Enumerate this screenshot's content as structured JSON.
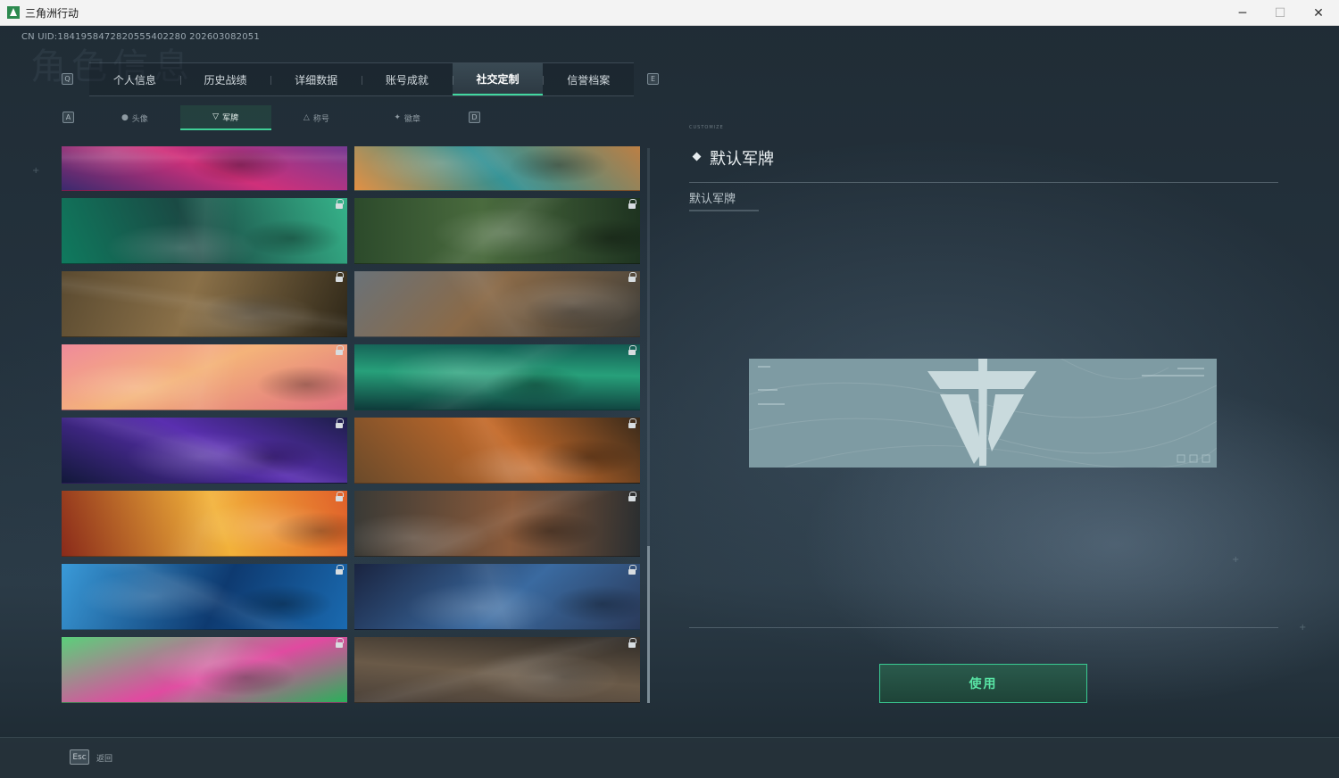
{
  "window": {
    "title": "三角洲行动",
    "minimize": "─",
    "maximize": "☐",
    "close": "✕"
  },
  "uid_text": "CN UID:1841958472820555402280 202603082051",
  "background_title": "角色信息",
  "main_tabs": {
    "prev_key": "Q",
    "next_key": "E",
    "items": [
      {
        "label": "个人信息"
      },
      {
        "label": "历史战绩"
      },
      {
        "label": "详细数据"
      },
      {
        "label": "账号成就"
      },
      {
        "label": "社交定制",
        "active": true
      },
      {
        "label": "信誉档案"
      }
    ]
  },
  "sub_tabs": {
    "prev_key": "A",
    "next_key": "D",
    "items": [
      {
        "label": "头像",
        "icon": "person-icon"
      },
      {
        "label": "军牌",
        "icon": "badge-icon",
        "active": true
      },
      {
        "label": "称号",
        "icon": "title-icon"
      },
      {
        "label": "徽章",
        "icon": "emblem-icon"
      }
    ]
  },
  "cards": [
    {
      "id": "banner-1",
      "colors": [
        "#3b2a6e",
        "#d0307a",
        "#5b3f9a"
      ],
      "locked": false
    },
    {
      "id": "banner-2",
      "colors": [
        "#e29044",
        "#2e8f92",
        "#cf7d3a"
      ],
      "locked": false
    },
    {
      "id": "banner-3",
      "colors": [
        "#0f7a5e",
        "#1a4a44",
        "#36b38a"
      ],
      "locked": true
    },
    {
      "id": "banner-4",
      "colors": [
        "#2c4a2b",
        "#4a6b3e",
        "#1e3320"
      ],
      "locked": true
    },
    {
      "id": "banner-5",
      "colors": [
        "#5a4a30",
        "#8a7048",
        "#2e2718"
      ],
      "locked": true
    },
    {
      "id": "banner-6",
      "colors": [
        "#6a7278",
        "#8a6a48",
        "#3a3a36"
      ],
      "locked": true
    },
    {
      "id": "banner-7",
      "colors": [
        "#f08a9a",
        "#f4b37a",
        "#e0707e"
      ],
      "locked": true
    },
    {
      "id": "banner-8",
      "colors": [
        "#135a52",
        "#27a07a",
        "#0e3a3a"
      ],
      "locked": true
    },
    {
      "id": "banner-9",
      "colors": [
        "#1d1e4a",
        "#5a2fb0",
        "#12183a"
      ],
      "locked": true
    },
    {
      "id": "banner-10",
      "colors": [
        "#3a2a1a",
        "#c46a2a",
        "#6a4a2a"
      ],
      "locked": true
    },
    {
      "id": "banner-11",
      "colors": [
        "#e0602a",
        "#f2b23a",
        "#8a2a1a"
      ],
      "locked": true
    },
    {
      "id": "banner-12",
      "colors": [
        "#2a2e30",
        "#8a5a3a",
        "#3a3a36"
      ],
      "locked": true
    },
    {
      "id": "banner-13",
      "colors": [
        "#1a6ab0",
        "#0e3a70",
        "#3a9ad8"
      ],
      "locked": true
    },
    {
      "id": "banner-14",
      "colors": [
        "#2a3a5a",
        "#3a6aa0",
        "#1a2440"
      ],
      "locked": true
    },
    {
      "id": "banner-15",
      "colors": [
        "#2ab05a",
        "#e04aa0",
        "#5ad07a"
      ],
      "locked": true
    },
    {
      "id": "banner-16",
      "colors": [
        "#4a4038",
        "#6a5a48",
        "#2e2a26"
      ],
      "locked": true
    }
  ],
  "detail": {
    "section_tag": "CUSTOMIZE",
    "title": "默认军牌",
    "subtitle": "默认军牌",
    "preview_bg": "#7e9ba3",
    "use_button": "使用"
  },
  "bottom": {
    "esc_key": "Esc",
    "back_label": "返回"
  },
  "accent_color": "#42d8a0"
}
